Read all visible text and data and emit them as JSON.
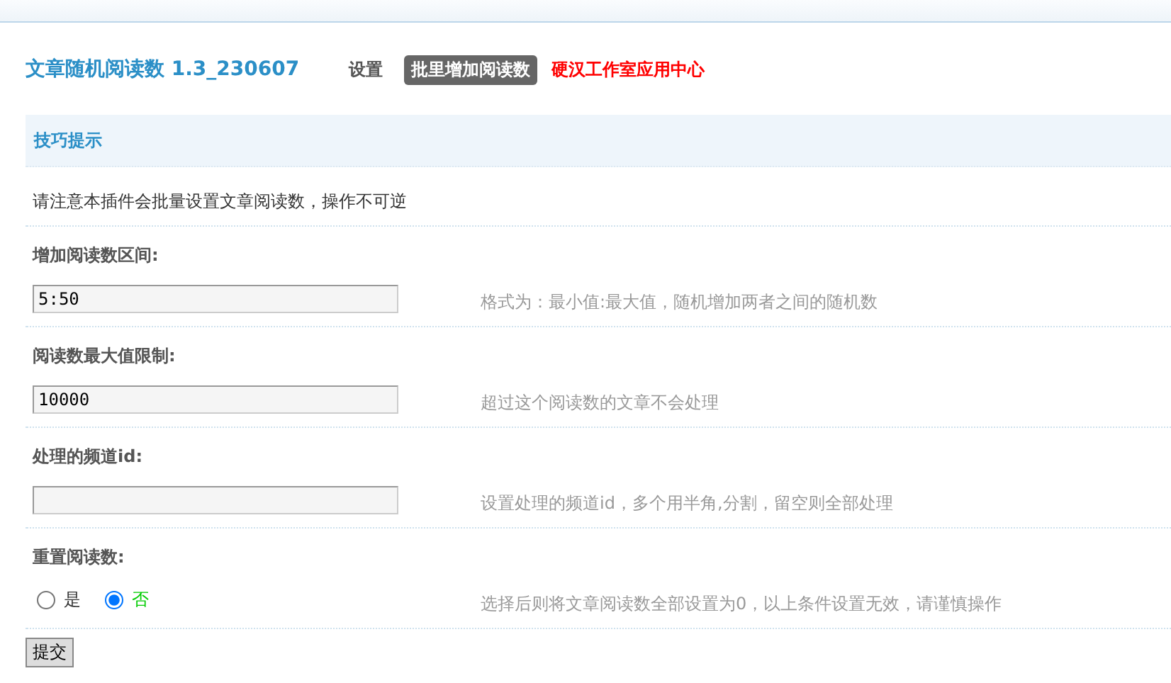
{
  "header": {
    "title": "文章随机阅读数 1.3_230607",
    "nav": [
      {
        "label": "设置",
        "selected": false
      },
      {
        "label": "批里增加阅读数",
        "selected": true
      }
    ],
    "app_center_link": "硬汉工作室应用中心"
  },
  "tips": {
    "title": "技巧提示"
  },
  "notice": "请注意本插件会批量设置文章阅读数，操作不可逆",
  "fields": [
    {
      "kind": "text",
      "label": "增加阅读数区间:",
      "value": "5:50",
      "hint": "格式为：最小值:最大值，随机增加两者之间的随机数"
    },
    {
      "kind": "text",
      "label": "阅读数最大值限制:",
      "value": "10000",
      "hint": "超过这个阅读数的文章不会处理"
    },
    {
      "kind": "text",
      "label": "处理的频道id:",
      "hint": "设置处理的频道id，多个用半角,分割，留空则全部处理"
    },
    {
      "kind": "radio",
      "label": "重置阅读数:",
      "options": [
        {
          "label": "是",
          "selected": false
        },
        {
          "label": "否",
          "selected": true
        }
      ],
      "hint": "选择后则将文章阅读数全部设置为0，以上条件设置无效，请谨慎操作"
    }
  ],
  "submit_button": "提交"
}
